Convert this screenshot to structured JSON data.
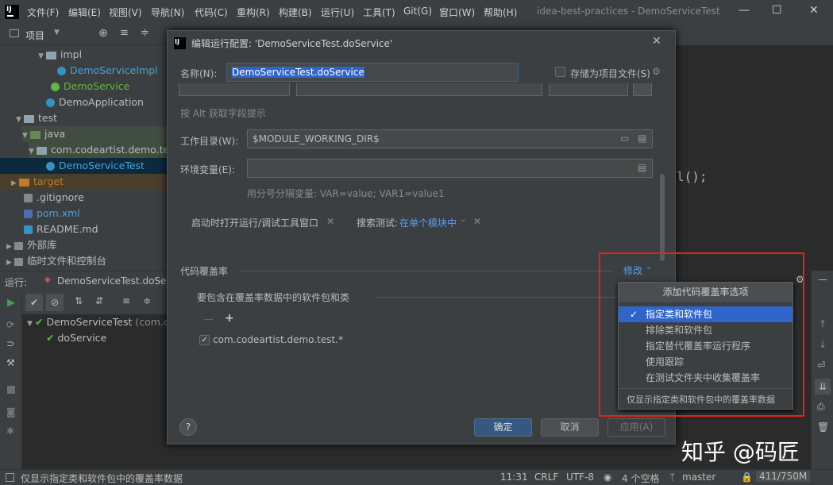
{
  "menu": [
    "文件(F)",
    "编辑(E)",
    "视图(V)",
    "导航(N)",
    "代码(C)",
    "重构(R)",
    "构建(B)",
    "运行(U)",
    "工具(T)",
    "Git(G)",
    "窗口(W)",
    "帮助(H)"
  ],
  "window_title": "idea-best-practices - DemoServiceTest",
  "project_panel": {
    "title": "项目",
    "tree": [
      {
        "label": "impl",
        "kind": "folder"
      },
      {
        "label": "DemoServiceImpl",
        "kind": "class"
      },
      {
        "label": "DemoService",
        "kind": "interface"
      },
      {
        "label": "DemoApplication",
        "kind": "class"
      },
      {
        "label": "test",
        "kind": "folder"
      },
      {
        "label": "java",
        "kind": "folder"
      },
      {
        "label": "com.codeartist.demo.tes",
        "kind": "package"
      },
      {
        "label": "DemoServiceTest",
        "kind": "class"
      },
      {
        "label": "target",
        "kind": "folder"
      },
      {
        "label": ".gitignore",
        "kind": "file"
      },
      {
        "label": "pom.xml",
        "kind": "file"
      },
      {
        "label": "README.md",
        "kind": "file"
      },
      {
        "label": "外部库",
        "kind": "lib"
      },
      {
        "label": "临时文件和控制台",
        "kind": "lib"
      }
    ]
  },
  "run_panel": {
    "label": "运行:",
    "config": "DemoServiceTest.doSer",
    "tree": [
      {
        "label": "DemoServiceTest",
        "suffix": "(com.c"
      },
      {
        "label": "doService",
        "suffix": ""
      }
    ]
  },
  "editor": {
    "code_snippet": "l();"
  },
  "dialog": {
    "title": "编辑运行配置: 'DemoServiceTest.doService'",
    "name_label": "名称(N):",
    "name_value": "DemoServiceTest.doService",
    "store_label": "存储为项目文件(S)",
    "field_hint": "按 Alt 获取字段提示",
    "workdir_label": "工作目录(W):",
    "workdir_value": "$MODULE_WORKING_DIR$",
    "env_label": "环境变量(E):",
    "env_value": "",
    "env_hint": "用分号分隔变量: VAR=value; VAR1=value1",
    "open_tool_window": "启动时打开运行/调试工具窗口",
    "search_tests_label": "搜索测试:",
    "search_tests_value": "在单个模块中",
    "coverage_label": "代码覆盖率",
    "modify_label": "修改",
    "include_label": "要包含在覆盖率数据中的软件包和类",
    "include_entries": [
      {
        "checked": true,
        "label": "com.codeartist.demo.test.*"
      }
    ],
    "ok_label": "确定",
    "cancel_label": "取消",
    "apply_label": "应用(A)",
    "help_label": "?"
  },
  "popup": {
    "header": "添加代码覆盖率选项",
    "items": [
      {
        "label": "指定类和软件包",
        "selected": true,
        "checked": true
      },
      {
        "label": "排除类和软件包",
        "selected": false,
        "checked": false
      },
      {
        "label": "指定替代覆盖率运行程序",
        "selected": false,
        "checked": false
      },
      {
        "label": "使用跟踪",
        "selected": false,
        "checked": false
      },
      {
        "label": "在测试文件夹中收集覆盖率",
        "selected": false,
        "checked": false
      }
    ],
    "footer": "仅显示指定类和软件包中的覆盖率数据"
  },
  "statusbar": {
    "message": "仅显示指定类和软件包中的覆盖率数据",
    "position": "11:31",
    "line_sep": "CRLF",
    "encoding": "UTF-8",
    "indent": "4 个空格",
    "branch": "master",
    "memory": "411/750M"
  },
  "watermark": "知乎 @码匠",
  "colors": {
    "accent": "#2f65ca",
    "link": "#589df6",
    "highlight_box": "#e1251b",
    "primary_button": "#365880"
  }
}
